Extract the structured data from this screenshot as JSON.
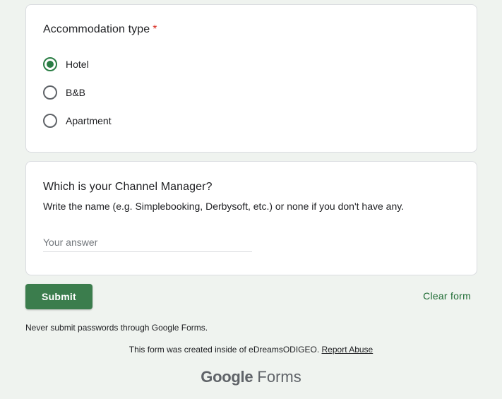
{
  "questions": [
    {
      "title": "Accommodation type",
      "required_marker": "*",
      "options": [
        {
          "label": "Hotel",
          "selected": true
        },
        {
          "label": "B&B",
          "selected": false
        },
        {
          "label": "Apartment",
          "selected": false
        }
      ]
    },
    {
      "title": "Which is your Channel Manager?",
      "description": "Write the name (e.g. Simplebooking, Derbysoft, etc.) or none if you don't have any.",
      "answer_value": "",
      "answer_placeholder": "Your answer"
    }
  ],
  "actions": {
    "submit_label": "Submit",
    "clear_label": "Clear form"
  },
  "footer": {
    "password_warning": "Never submit passwords through Google Forms.",
    "created_inside": "This form was created inside of eDreamsODIGEO.",
    "report_abuse": "Report Abuse",
    "brand_google": "Google",
    "brand_forms": "Forms"
  },
  "colors": {
    "accent": "#3b7d4d",
    "radio_selected": "#2a7d44",
    "required": "#d93025",
    "background": "#eff3ef"
  }
}
